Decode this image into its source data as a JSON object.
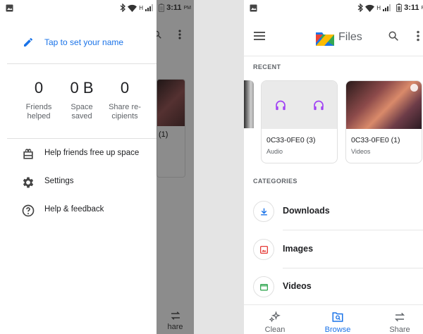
{
  "status_bar": {
    "network": "H",
    "time": "3:11",
    "ampm": "PM"
  },
  "drawer": {
    "name_prompt": "Tap to set your name",
    "stats": [
      {
        "value": "0",
        "label_line1": "Friends",
        "label_line2": "helped"
      },
      {
        "value": "0 B",
        "label_line1": "Space",
        "label_line2": "saved"
      },
      {
        "value": "0",
        "label_line1": "Share re-",
        "label_line2": "cipients"
      }
    ],
    "menu": [
      {
        "label": "Help friends free up space",
        "icon": "gift-icon"
      },
      {
        "label": "Settings",
        "icon": "gear-icon"
      },
      {
        "label": "Help & feedback",
        "icon": "help-icon"
      }
    ]
  },
  "background_app": {
    "card_caption": "(1)",
    "share_label": "hare"
  },
  "files_app": {
    "title": "Files",
    "recent_header": "RECENT",
    "categories_header": "CATEGORIES",
    "recent": [
      {
        "name": "0C33-0FE0 (3)",
        "type": "Audio"
      },
      {
        "name": "0C33-0FE0 (1)",
        "type": "Videos"
      }
    ],
    "categories": [
      {
        "label": "Downloads",
        "icon": "download-icon",
        "color": "#1a73e8"
      },
      {
        "label": "Images",
        "icon": "image-icon",
        "color": "#e53935"
      },
      {
        "label": "Videos",
        "icon": "video-icon",
        "color": "#34a853"
      }
    ],
    "bottom_nav": [
      {
        "label": "Clean",
        "icon": "sparkle-icon",
        "active": false
      },
      {
        "label": "Browse",
        "icon": "browse-icon",
        "active": true
      },
      {
        "label": "Share",
        "icon": "share-arrows-icon",
        "active": false
      }
    ]
  },
  "colors": {
    "accent_blue": "#1a73e8",
    "audio_purple": "#a142f4",
    "scrim": "rgba(0,0,0,0.45)"
  }
}
